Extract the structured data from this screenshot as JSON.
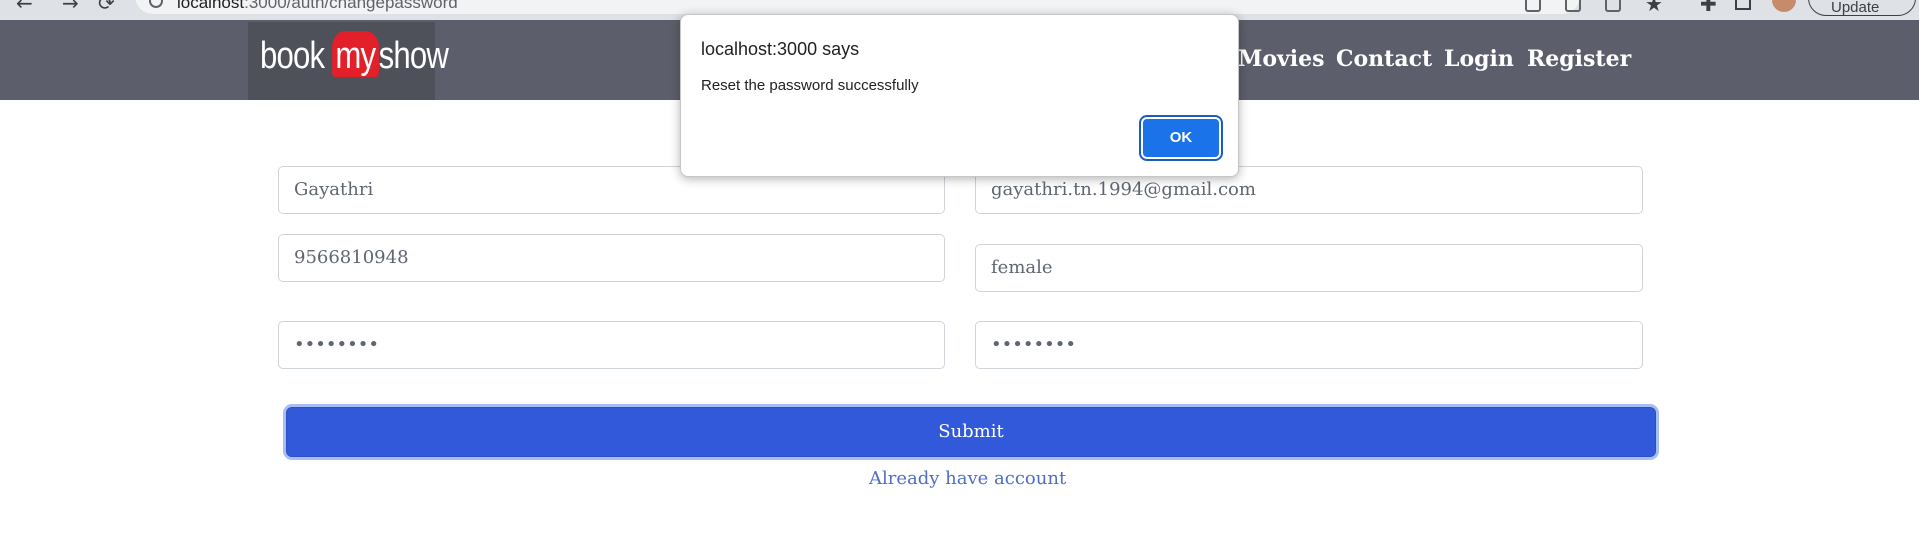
{
  "browser": {
    "url_host": "localhost",
    "url_path": ":3000/auth/changepassword",
    "update_label": "Update"
  },
  "header": {
    "logo": {
      "part1": "book",
      "part2": "my",
      "part3": "show"
    },
    "nav": {
      "movies": "Movies",
      "contact": "Contact",
      "login": "Login",
      "register": "Register"
    }
  },
  "form": {
    "name": "Gayathri",
    "email": "gayathri.tn.1994@gmail.com",
    "phone": "9566810948",
    "gender": "female",
    "password": "••••••••",
    "confirm_password": "••••••••",
    "submit_label": "Submit",
    "login_link": "Already have account"
  },
  "dialog": {
    "title": "localhost:3000 says",
    "message": "Reset the password successfully",
    "ok_label": "OK"
  }
}
